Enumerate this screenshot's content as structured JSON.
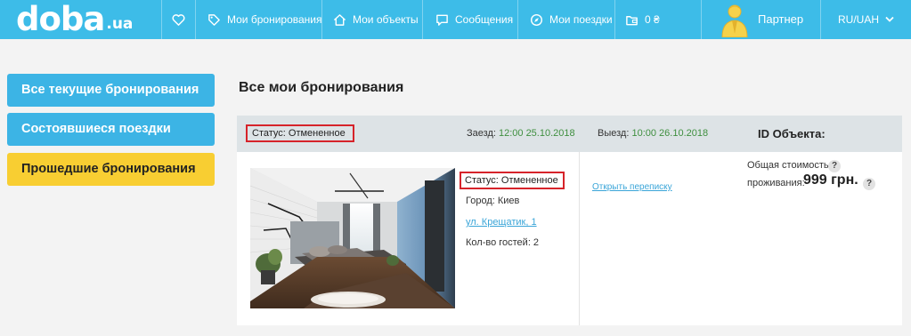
{
  "header": {
    "logo_main": "doba",
    "logo_sub": ".ua",
    "nav": [
      {
        "label": "Мои бронирования"
      },
      {
        "label": "Мои объекты"
      },
      {
        "label": "Сообщения"
      },
      {
        "label": "Мои поездки"
      },
      {
        "label": "0 ₴"
      }
    ],
    "partner_label": "Партнер",
    "lang_currency": "RU/UAH"
  },
  "sidebar": {
    "items": [
      {
        "label": "Все текущие бронирования",
        "style": "blue"
      },
      {
        "label": "Состоявшиеся поездки",
        "style": "blue"
      },
      {
        "label": "Прошедшие бронирования",
        "style": "yellow",
        "active": true
      }
    ]
  },
  "main": {
    "title": "Все мои бронирования",
    "booking": {
      "header_status": "Статус: Отмененное",
      "checkin_label": "Заезд:",
      "checkin_value": "12:00 25.10.2018",
      "checkout_label": "Выезд:",
      "checkout_value": "10:00 26.10.2018",
      "object_id_label": "ID Объекта:",
      "status": "Статус: Отмененное",
      "city": "Город: Киев",
      "address": "ул. Крещатик, 1",
      "guests": "Кол-во гостей: 2",
      "chat_link": "Открыть переписку",
      "total_label_line1": "Общая стоимость",
      "total_label_line2": "проживания:",
      "total_value": "999 грн.",
      "help_mark": "?"
    }
  },
  "colors": {
    "header_bg": "#3dbce8",
    "sidebar_blue": "#3cb4e5",
    "sidebar_yellow": "#f8ce32",
    "status_highlight": "#d6232a",
    "date_green": "#3f8f3f",
    "link_blue": "#3aa5d8"
  },
  "icons": [
    "heart-icon",
    "tag-icon",
    "home-icon",
    "chat-icon",
    "compass-icon",
    "wallet-icon",
    "partner-avatar",
    "chevron-down-icon"
  ]
}
